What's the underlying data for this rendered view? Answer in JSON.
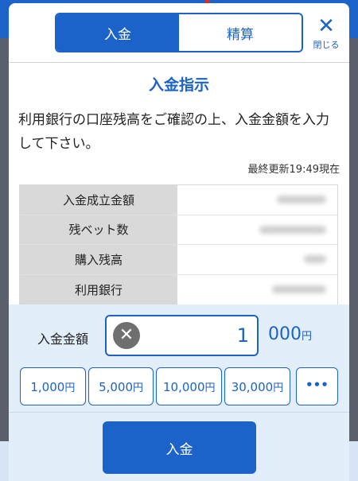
{
  "tabs": [
    {
      "label": "入金",
      "active": true
    },
    {
      "label": "精算",
      "active": false
    }
  ],
  "close": {
    "icon": "close-icon",
    "label": "閉じる"
  },
  "title": "入金指示",
  "instruction": "利用銀行の口座残高をご確認の上、入金金額を入力して下さい。",
  "updated": "最終更新19:49現在",
  "info_rows": [
    {
      "label": "入金成立金額"
    },
    {
      "label": "残ベット数"
    },
    {
      "label": "購入残高"
    },
    {
      "label": "利用銀行"
    }
  ],
  "amount": {
    "label": "入金金額",
    "value": "1",
    "suffix_number": "000",
    "suffix_unit": "円",
    "clear_icon": "clear-icon"
  },
  "presets": [
    {
      "number": "1,000",
      "unit": "円"
    },
    {
      "number": "5,000",
      "unit": "円"
    },
    {
      "number": "10,000",
      "unit": "円"
    },
    {
      "number": "30,000",
      "unit": "円"
    }
  ],
  "more_label": "•••",
  "submit_label": "入金",
  "colors": {
    "accent": "#1b62c9",
    "panel": "#e3eefb",
    "label_bg": "#d9d9d9"
  }
}
